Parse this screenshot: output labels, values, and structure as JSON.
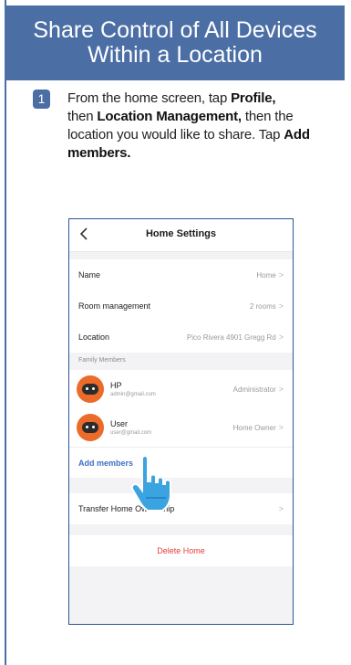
{
  "header": {
    "line1": "Share Control of All Devices",
    "line2": "Within a Location"
  },
  "step": {
    "number": "1",
    "t1": "From the home screen, tap ",
    "b1": "Profile,",
    "t2": "then ",
    "b2": "Location Management,",
    "t3": " then the location you would like to share. Tap ",
    "b3": "Add members."
  },
  "phone": {
    "title": "Home Settings",
    "rows": {
      "name_label": "Name",
      "name_value": "Home",
      "room_label": "Room management",
      "room_value": "2 rooms",
      "location_label": "Location",
      "location_value": "Pico Rivera 4901 Gregg Rd"
    },
    "family_label": "Family Members",
    "members": [
      {
        "name": "HP",
        "email": "admin@gmail.com",
        "role": "Administrator"
      },
      {
        "name": "User",
        "email": "user@gmail.com",
        "role": "Home Owner"
      }
    ],
    "add_members": "Add members",
    "transfer": "Transfer Home Ownership",
    "delete": "Delete Home",
    "chevron": ">"
  },
  "colors": {
    "header_bg": "#4b6fa5",
    "accent_blue": "#3d6fc4",
    "delete_red": "#e0423c",
    "avatar_orange": "#ec6a2a"
  },
  "icons": [
    "back-chevron-icon",
    "chevron-right-icon",
    "avatar-icon",
    "pointing-hand-icon"
  ]
}
